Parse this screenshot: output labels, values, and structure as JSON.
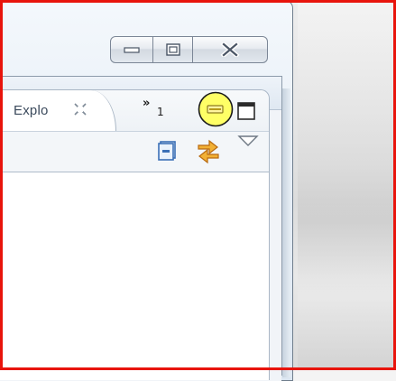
{
  "window": {
    "caption_buttons": [
      {
        "name": "minimize",
        "icon": "minimize-icon"
      },
      {
        "name": "maximize",
        "icon": "maximize-icon"
      },
      {
        "name": "close",
        "icon": "close-icon"
      }
    ]
  },
  "view": {
    "tab_label": "Explo",
    "tab_close_icon": "close-tab-icon",
    "overflow_glyph": "»",
    "overflow_count": "1",
    "minimize_icon": "view-minimize-icon",
    "maximize_icon": "view-maximize-icon"
  },
  "toolbar": {
    "icons": [
      "collapse-all-icon",
      "link-with-editor-icon",
      "view-menu-icon"
    ]
  },
  "content": {
    "stray_text": ":"
  },
  "colors": {
    "highlight_border": "#e8140c",
    "highlight_circle": "#ffff66",
    "accent_blue": "#3b6fb6",
    "accent_orange": "#e08a1e"
  }
}
